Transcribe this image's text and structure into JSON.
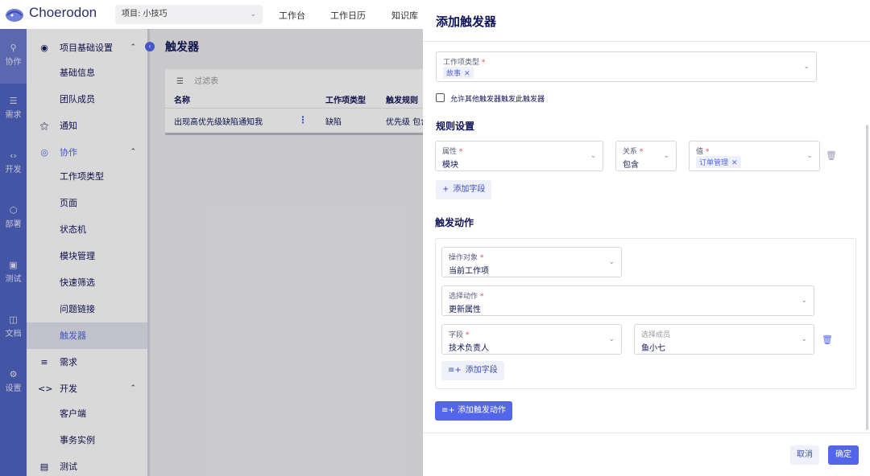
{
  "header": {
    "brand": "Choerodon",
    "project_select": "项目: 小技巧",
    "nav": [
      "工作台",
      "工作日历",
      "知识库"
    ]
  },
  "rail": [
    {
      "label": "协作",
      "icon": "collab-icon"
    },
    {
      "label": "需求",
      "icon": "layers-icon"
    },
    {
      "label": "开发",
      "icon": "code-icon"
    },
    {
      "label": "部署",
      "icon": "deploy-icon"
    },
    {
      "label": "测试",
      "icon": "clipboard-icon"
    },
    {
      "label": "文档",
      "icon": "doc-icon"
    },
    {
      "label": "设置",
      "icon": "settings-icon"
    }
  ],
  "menu": {
    "group1": "项目基础设置",
    "g1_items": [
      "基础信息",
      "团队成员"
    ],
    "notify": "通知",
    "group2": "协作",
    "g2_items": [
      "工作项类型",
      "页面",
      "状态机",
      "模块管理",
      "快速筛选",
      "问题链接",
      "触发器"
    ],
    "req": "需求",
    "dev": "开发",
    "dev_items": [
      "客户端",
      "事务实例"
    ],
    "test": "测试"
  },
  "page": {
    "title": "触发器",
    "filter_placeholder": "过滤表",
    "columns": [
      "名称",
      "工作项类型",
      "触发规则"
    ],
    "row": {
      "name": "出现高优先级缺陷通知我",
      "type": "缺陷",
      "rule": "优先级 包含"
    }
  },
  "drawer": {
    "title": "添加触发器",
    "issue_type": {
      "label": "工作项类型",
      "tag": "故事"
    },
    "allow_checkbox": "允许其他触发器触发此触发器",
    "rules_section": "规则设置",
    "rule": {
      "attr_label": "属性",
      "attr_value": "模块",
      "rel_label": "关系",
      "rel_value": "包含",
      "val_label": "值",
      "val_tag": "订单管理"
    },
    "add_field": "添加字段",
    "actions_section": "触发动作",
    "action": {
      "target_label": "操作对象",
      "target_value": "当前工作项",
      "act_label": "选择动作",
      "act_value": "更新属性",
      "field_label": "字段",
      "field_value": "技术负责人",
      "member_label": "选择成员",
      "member_value": "鱼小七"
    },
    "add_action": "添加触发动作",
    "cancel": "取消",
    "confirm": "确定"
  },
  "colors": {
    "primary": "#5365EA",
    "rail": "#5264c3",
    "required": "#e5484d"
  }
}
